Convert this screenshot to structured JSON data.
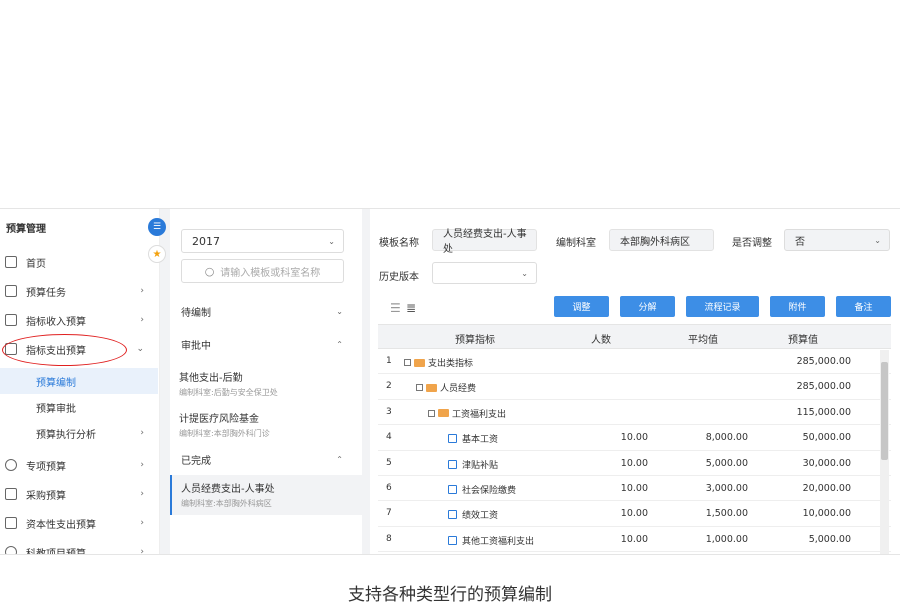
{
  "sidebar": {
    "title": "预算管理",
    "items": [
      {
        "label": "首页",
        "icon": "home-icon",
        "arrow": ""
      },
      {
        "label": "预算任务",
        "icon": "clipboard-icon",
        "arrow": "›"
      },
      {
        "label": "指标收入预算",
        "icon": "income-icon",
        "arrow": "›"
      },
      {
        "label": "指标支出预算",
        "icon": "expense-icon",
        "arrow": "⌄"
      },
      {
        "label": "专项预算",
        "icon": "special-icon",
        "arrow": "›"
      },
      {
        "label": "采购预算",
        "icon": "purchase-icon",
        "arrow": "›"
      },
      {
        "label": "资本性支出预算",
        "icon": "capital-icon",
        "arrow": "›"
      },
      {
        "label": "科教项目预算",
        "icon": "research-icon",
        "arrow": "›"
      }
    ],
    "subitems": [
      {
        "label": "预算编制",
        "arrow": ""
      },
      {
        "label": "预算审批",
        "arrow": ""
      },
      {
        "label": "预算执行分析",
        "arrow": "›"
      }
    ]
  },
  "mid": {
    "year": "2017",
    "search_placeholder": "请输入模板或科室名称",
    "groups": [
      {
        "label": "待编制",
        "caret": "⌄"
      },
      {
        "label": "审批中",
        "caret": "⌃"
      },
      {
        "label": "已完成",
        "caret": "⌃"
      }
    ],
    "cards": [
      {
        "title": "其他支出-后勤",
        "sub": "编制科室:后勤与安全保卫处"
      },
      {
        "title": "计提医疗风险基金",
        "sub": "编制科室:本部胸外科门诊"
      },
      {
        "title": "人员经费支出-人事处",
        "sub": "编制科室:本部胸外科病区"
      }
    ]
  },
  "form": {
    "template_label": "模板名称",
    "template_value": "人员经费支出-人事处",
    "dept_label": "编制科室",
    "dept_value": "本部胸外科病区",
    "adjust_label": "是否调整",
    "adjust_value": "否",
    "history_label": "历史版本",
    "history_value": ""
  },
  "buttons": [
    "调整",
    "分解",
    "流程记录",
    "附件",
    "备注"
  ],
  "table": {
    "headers": [
      "预算指标",
      "人数",
      "平均值",
      "预算值"
    ],
    "rows": [
      {
        "no": "1",
        "name": "支出类指标",
        "type": "folder",
        "level": 0,
        "people": "",
        "avg": "",
        "budget": "285,000.00"
      },
      {
        "no": "2",
        "name": "人员经费",
        "type": "folder",
        "level": 1,
        "people": "",
        "avg": "",
        "budget": "285,000.00"
      },
      {
        "no": "3",
        "name": "工资福利支出",
        "type": "folder",
        "level": 2,
        "people": "",
        "avg": "",
        "budget": "115,000.00"
      },
      {
        "no": "4",
        "name": "基本工资",
        "type": "doc",
        "level": 3,
        "people": "10.00",
        "avg": "8,000.00",
        "budget": "50,000.00"
      },
      {
        "no": "5",
        "name": "津贴补贴",
        "type": "doc",
        "level": 3,
        "people": "10.00",
        "avg": "5,000.00",
        "budget": "30,000.00"
      },
      {
        "no": "6",
        "name": "社会保险缴费",
        "type": "doc",
        "level": 3,
        "people": "10.00",
        "avg": "3,000.00",
        "budget": "20,000.00"
      },
      {
        "no": "7",
        "name": "绩效工资",
        "type": "doc",
        "level": 3,
        "people": "10.00",
        "avg": "1,500.00",
        "budget": "10,000.00"
      },
      {
        "no": "8",
        "name": "其他工资福利支出",
        "type": "doc",
        "level": 3,
        "people": "10.00",
        "avg": "1,000.00",
        "budget": "5,000.00"
      }
    ]
  },
  "caption": "支持各种类型行的预算编制"
}
